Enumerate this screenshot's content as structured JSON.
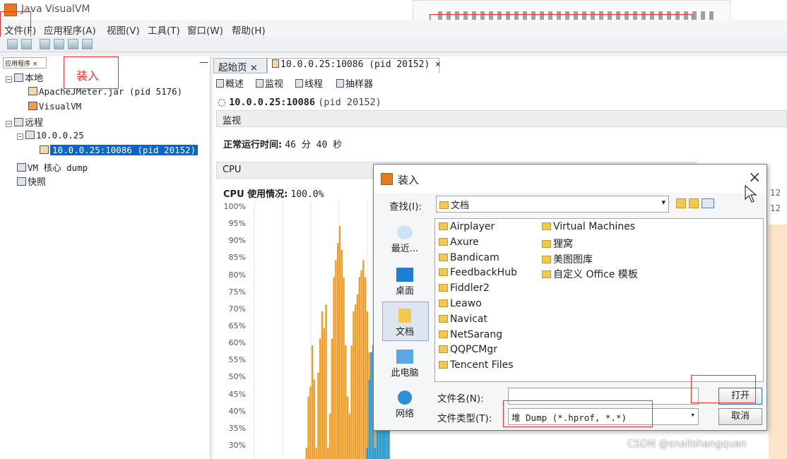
{
  "window": {
    "title": "Java VisualVM"
  },
  "menu": [
    "文件(F)",
    "应用程序(A)",
    "视图(V)",
    "工具(T)",
    "窗口(W)",
    "帮助(H)"
  ],
  "left_panel": {
    "tab": "应用程序",
    "tree": [
      {
        "label": "本地"
      },
      {
        "label": "ApacheJMeter.jar (pid 5176)"
      },
      {
        "label": "VisualVM"
      },
      {
        "label": "远程"
      },
      {
        "label": "10.0.0.25"
      },
      {
        "label": "10.0.0.25:10086 (pid 20152)"
      },
      {
        "label": "VM 核心 dump"
      },
      {
        "label": "快照"
      }
    ]
  },
  "annotation": {
    "load_label": "装入"
  },
  "tabs": {
    "start": "起始页",
    "process": "10.0.0.25:10086 (pid 20152)"
  },
  "subtabs": [
    "概述",
    "监视",
    "线程",
    "抽样器"
  ],
  "monitor": {
    "header": "10.0.0.25:10086",
    "header_pid": "(pid 20152)",
    "section": "监视",
    "uptime_label": "正常运行时间:",
    "uptime_value": "46 分 40 秒",
    "cpu_section": "CPU",
    "cpu_usage_label": "CPU 使用情况:",
    "cpu_usage_value": "100.0%"
  },
  "chart_data": {
    "type": "area",
    "ytick_labels": [
      "100%",
      "95%",
      "90%",
      "85%",
      "80%",
      "75%",
      "70%",
      "65%",
      "60%",
      "55%",
      "50%",
      "45%",
      "40%",
      "35%",
      "30%"
    ],
    "ylim": [
      30,
      100
    ],
    "series": [
      {
        "color": "#f29a21",
        "values": [
          0,
          0,
          0,
          0,
          0,
          0,
          0,
          0,
          0,
          0,
          0,
          0,
          0,
          0,
          0,
          0,
          0,
          0,
          0,
          0,
          0,
          0,
          0,
          0,
          0,
          0,
          0,
          0,
          0,
          30,
          45,
          48,
          60,
          50,
          30,
          52,
          62,
          70,
          65,
          72,
          30,
          40,
          62,
          80,
          85,
          90,
          95,
          88,
          80,
          60,
          45,
          40,
          60,
          70,
          72,
          75,
          80,
          82,
          85,
          80,
          70,
          58,
          30,
          40,
          55,
          62,
          70,
          75,
          80,
          85,
          90,
          88
        ]
      },
      {
        "color": "#1b98d8",
        "values": [
          0,
          0,
          0,
          0,
          0,
          0,
          0,
          0,
          0,
          0,
          0,
          0,
          0,
          0,
          0,
          0,
          0,
          0,
          0,
          0,
          0,
          0,
          0,
          0,
          0,
          0,
          0,
          0,
          0,
          0,
          0,
          0,
          0,
          0,
          0,
          0,
          0,
          0,
          0,
          0,
          0,
          0,
          0,
          0,
          0,
          0,
          0,
          0,
          0,
          0,
          0,
          0,
          0,
          0,
          0,
          0,
          0,
          0,
          0,
          0,
          30,
          50,
          58,
          60,
          30,
          40,
          55,
          60,
          65,
          68,
          72,
          60
        ]
      }
    ]
  },
  "right_edge_text": "12",
  "dialog": {
    "title": "装入",
    "look_in_label": "查找(I):",
    "look_in_value": "文档",
    "places": [
      "最近...",
      "桌面",
      "文档",
      "此电脑",
      "网络"
    ],
    "files_col1": [
      "Airplayer",
      "Axure",
      "Bandicam",
      "FeedbackHub",
      "Fiddler2",
      "Leawo",
      "Navicat",
      "NetSarang",
      "QQPCMgr",
      "Tencent Files"
    ],
    "files_col2": [
      "Virtual Machines",
      "狸窝",
      "美图图库",
      "自定义 Office 模板"
    ],
    "filename_label": "文件名(N):",
    "filename_value": "",
    "filetype_label": "文件类型(T):",
    "filetype_value": "堆 Dump (*.hprof, *.*)",
    "open_button": "打开",
    "cancel_button": "取消"
  },
  "watermark": "CSDN @snailshangquan"
}
